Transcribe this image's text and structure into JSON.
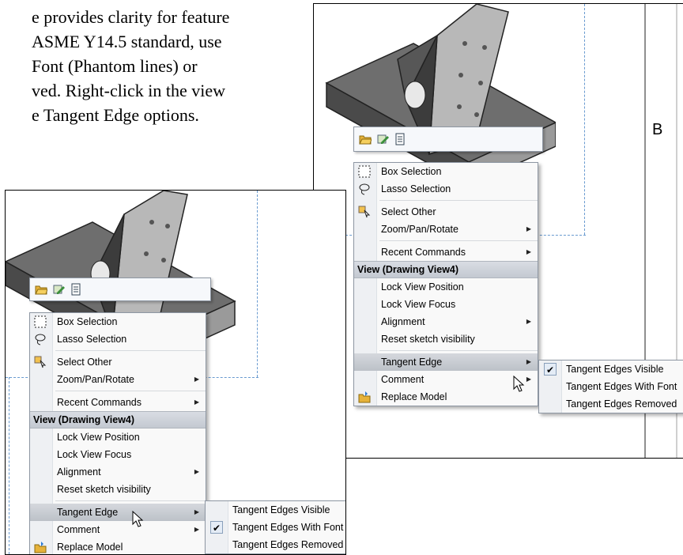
{
  "intro": {
    "line1": "e provides clarity for feature",
    "line2": "ASME Y14.5 standard, use",
    "line3": "Font (Phantom lines) or",
    "line4": "ved. Right-click in the view",
    "line5": "e Tangent Edge options."
  },
  "icons": {
    "toolbar": [
      "open-folder-icon",
      "edit-sketch-icon",
      "properties-icon"
    ],
    "box_selection": "box-selection-icon",
    "lasso_selection": "lasso-icon",
    "select_other": "select-other-icon",
    "replace_model": "replace-model-icon",
    "cursor": "mouse-pointer-icon",
    "checkmark": "checkmark-icon"
  },
  "colors": {
    "menu_header": "#c8cdd4",
    "highlight": "#c4c8ce",
    "dashed_border": "#6a9bd0"
  },
  "menu": {
    "box_selection": "Box Selection",
    "lasso_selection": "Lasso Selection",
    "select_other": "Select Other",
    "zoom_pan_rotate": "Zoom/Pan/Rotate",
    "recent_commands": "Recent Commands",
    "view_header": "View (Drawing View4)",
    "lock_view_position": "Lock View Position",
    "lock_view_focus": "Lock View Focus",
    "alignment": "Alignment",
    "reset_sketch": "Reset sketch visibility",
    "tangent_edge": "Tangent Edge",
    "comment": "Comment",
    "replace_model": "Replace Model"
  },
  "submenu": {
    "visible": "Tangent Edges Visible",
    "with_font": "Tangent Edges With Font",
    "removed": "Tangent Edges Removed",
    "check_mark": "✔"
  },
  "right_shot": {
    "checked": "visible",
    "border_label": "B"
  },
  "left_shot": {
    "checked": "with_font"
  }
}
